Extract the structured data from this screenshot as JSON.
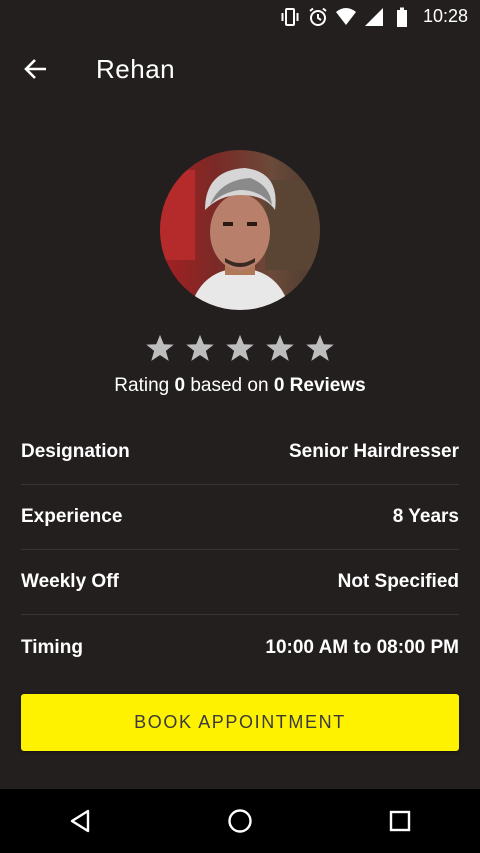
{
  "status_bar": {
    "time": "10:28",
    "icons": [
      "vibrate-icon",
      "alarm-icon",
      "wifi-icon",
      "signal-icon",
      "battery-icon"
    ]
  },
  "toolbar": {
    "title": "Rehan",
    "back_icon": "arrow-left-icon"
  },
  "profile": {
    "avatar": "profile-photo",
    "rating_stars_filled": 0,
    "rating_stars_total": 5,
    "rating_label": "Rating",
    "rating_value": "0",
    "based_on_label": "based on",
    "reviews_count": "0",
    "reviews_label": "Reviews"
  },
  "details": [
    {
      "label": "Designation",
      "value": "Senior Hairdresser"
    },
    {
      "label": "Experience",
      "value": "8 Years"
    },
    {
      "label": "Weekly Off",
      "value": "Not Specified"
    },
    {
      "label": "Timing",
      "value": "10:00 AM to 08:00 PM"
    }
  ],
  "book_button": {
    "label": "BOOK APPOINTMENT"
  },
  "colors": {
    "background": "#231f1e",
    "accent": "#fff200",
    "star": "#bdbdbd"
  },
  "nav_bar": {
    "icons": [
      "back-triangle-icon",
      "home-circle-icon",
      "recents-square-icon"
    ]
  }
}
